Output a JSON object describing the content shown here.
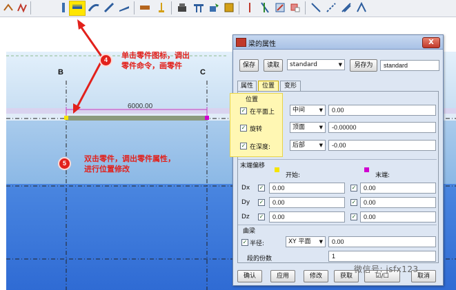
{
  "toolbar": {
    "icons": [
      "beam-tool-icon",
      "polybeam-tool-icon",
      "column-icon",
      "highlighted-beam-icon",
      "curved-beam-icon",
      "bent-plate-icon",
      "pad-footing-icon",
      "strip-footing-icon",
      "rebar-icon",
      "bolt-icon",
      "cut-icon",
      "fitting-icon",
      "weld-icon",
      "plate-icon",
      "contour-plate-icon",
      "line-cut-icon",
      "part-cut-icon",
      "chamfer-icon",
      "edge-icon",
      "polygon-icon",
      "snap-icon"
    ],
    "highlight_color": "#ffe600"
  },
  "canvas": {
    "grid_labels": [
      "B",
      "C"
    ],
    "dimension": "6000.00",
    "annotations": [
      {
        "step": "4",
        "text_line1": "单击零件图标，调出",
        "text_line2": "零件命令，画零件"
      },
      {
        "step": "5",
        "text_line1": "双击零件，调出零件属性，",
        "text_line2": "进行位置修改"
      }
    ],
    "annotation_color": "#e2211c",
    "beam_color": "#8b9a7e"
  },
  "dialog": {
    "title": "梁的属性",
    "close": "X",
    "buttons": {
      "save": "保存",
      "load": "读取",
      "save_as": "另存为"
    },
    "preset_value": "standard",
    "save_as_value": "standard",
    "tabs": [
      "属性",
      "位置",
      "变形"
    ],
    "active_tab": "位置",
    "position": {
      "section": "位置",
      "rows": [
        {
          "label": "在平面上",
          "checked": "✓",
          "option": "中间",
          "value": "0.00"
        },
        {
          "label": "旋转",
          "checked": "✓",
          "option": "顶面",
          "value": "-0.00000"
        },
        {
          "label": "在深度:",
          "checked": "✓",
          "option": "后部",
          "value": "-0.00"
        }
      ]
    },
    "end_offset": {
      "section": "末端偏移",
      "start_label": "开始:",
      "end_label": "末端:",
      "start_color": "#f5e400",
      "end_color": "#d000d0",
      "rows": [
        {
          "axis": "Dx",
          "start": "0.00",
          "end": "0.00"
        },
        {
          "axis": "Dy",
          "start": "0.00",
          "end": "0.00"
        },
        {
          "axis": "Dz",
          "start": "0.00",
          "end": "0.00"
        }
      ]
    },
    "curve": {
      "section": "曲梁",
      "radius_label": "半径:",
      "plane_option": "XY 平面",
      "radius_value": "0.00",
      "segments_label": "段的份数",
      "segments_value": "1"
    },
    "footer": {
      "ok": "确认",
      "apply": "应用",
      "modify": "修改",
      "get": "获取",
      "toggle": "☑/☐",
      "cancel": "取消"
    }
  },
  "watermark": "微信号: jsfx123"
}
